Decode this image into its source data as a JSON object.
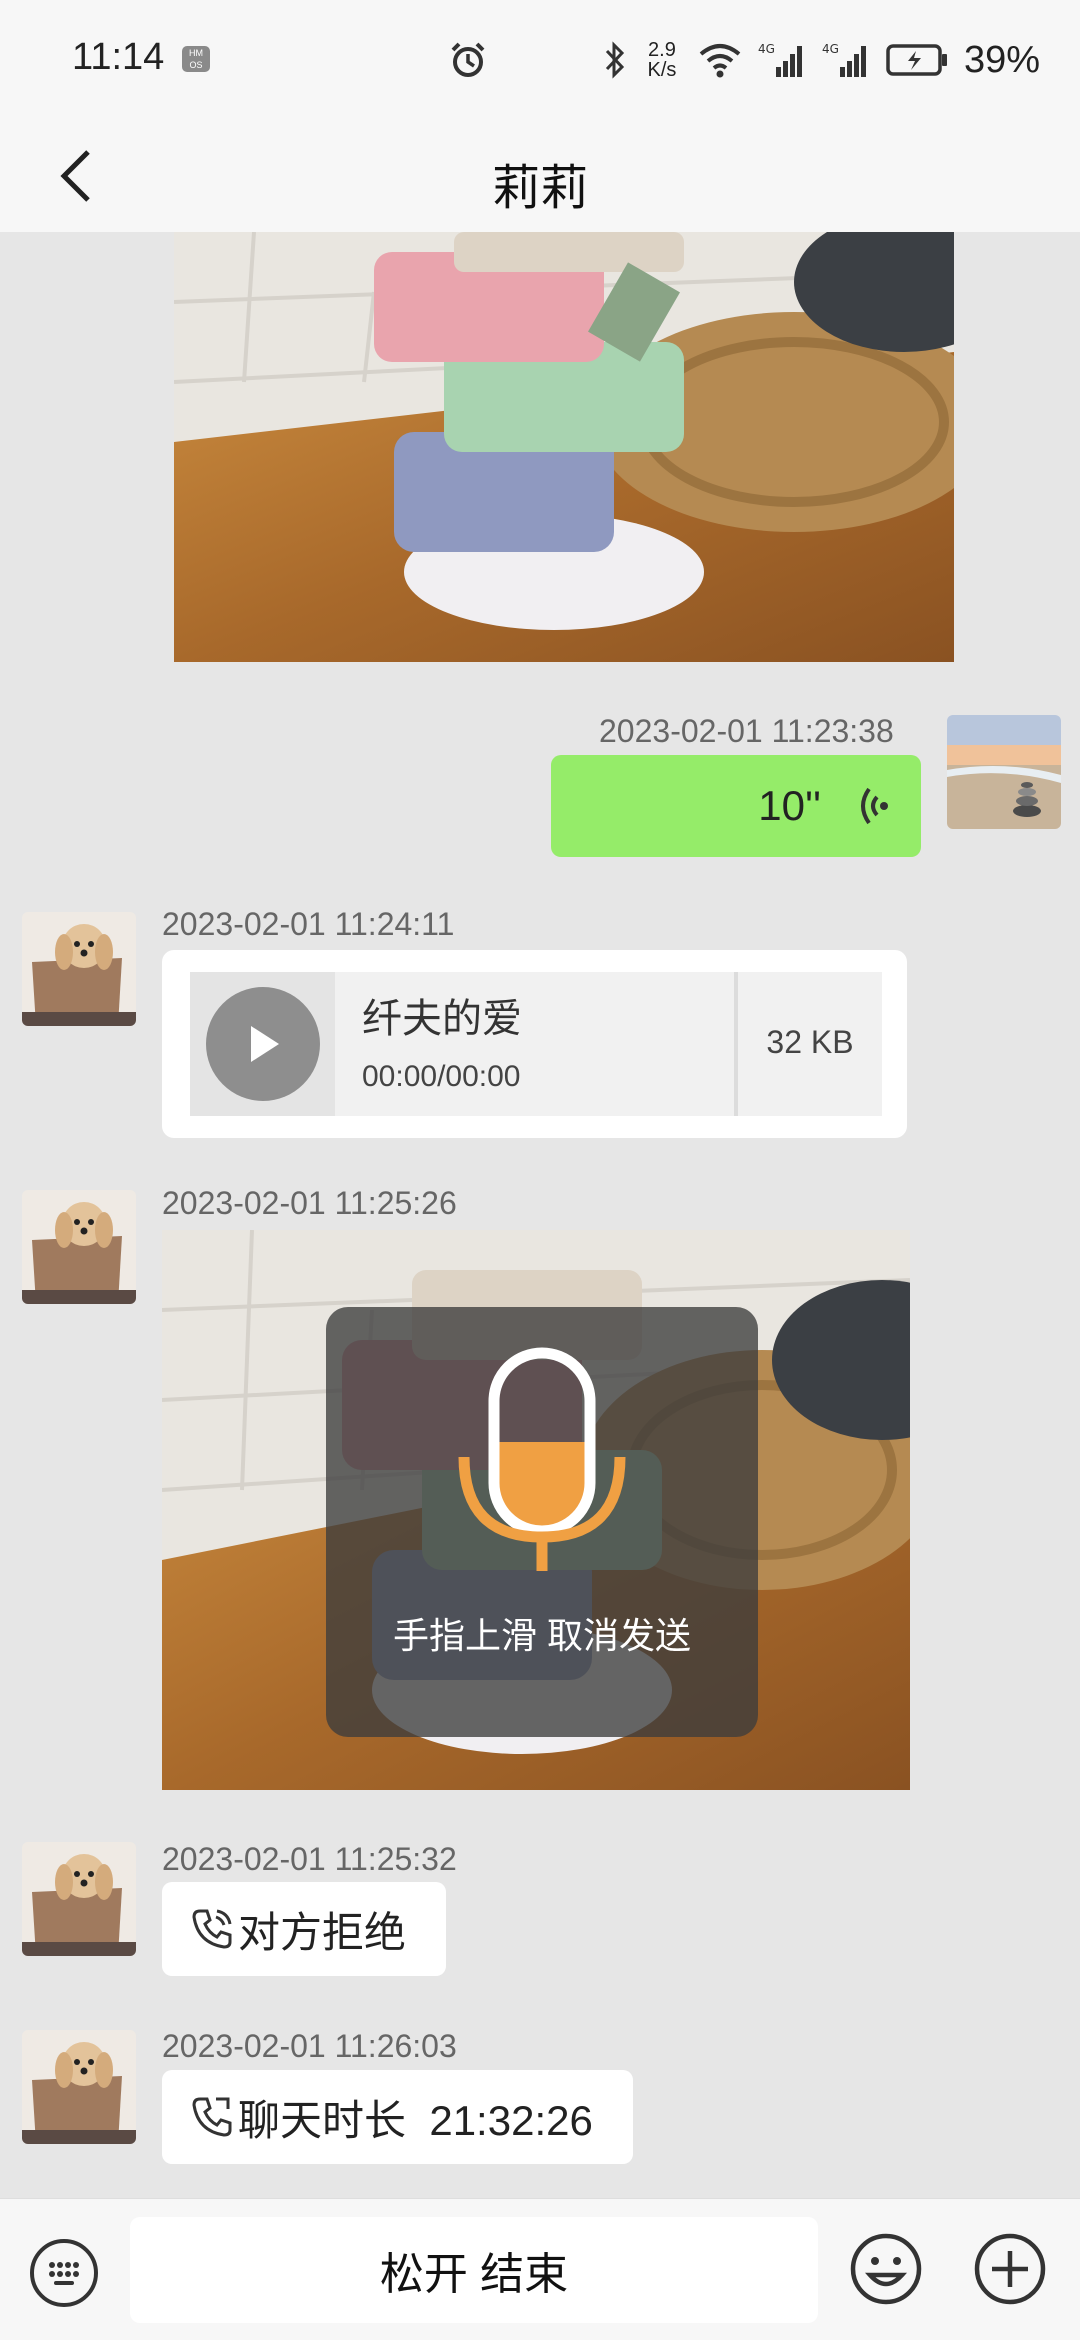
{
  "status_bar": {
    "time": "11:14",
    "os_badge": "HM OS",
    "speed_value": "2.9",
    "speed_unit": "K/s",
    "battery": "39%",
    "icons": [
      "alarm-icon",
      "bluetooth-icon",
      "wifi-icon",
      "signal-4g-icon",
      "signal-4g-icon",
      "battery-icon"
    ]
  },
  "header": {
    "title": "莉莉",
    "back_icon": "back-arrow-icon"
  },
  "messages": {
    "voice_sent": {
      "timestamp": "2023-02-01 11:23:38",
      "duration": "10''"
    },
    "music": {
      "timestamp": "2023-02-01 11:24:11",
      "title": "纤夫的爱",
      "progress": "00:00/00:00",
      "size": "32 KB"
    },
    "video": {
      "timestamp": "2023-02-01 11:25:26"
    },
    "call_rejected": {
      "timestamp": "2023-02-01 11:25:32",
      "text": "对方拒绝"
    },
    "call_duration": {
      "timestamp": "2023-02-01 11:26:03",
      "text": "聊天时长  21:32:26"
    }
  },
  "record_overlay": {
    "hint": "手指上滑 取消发送",
    "level": 0.5
  },
  "bottom_bar": {
    "hold_label": "松开 结束"
  },
  "colors": {
    "sent_bubble": "#95ec69",
    "mic_accent": "#f0a043",
    "background": "#e6e6e6"
  }
}
